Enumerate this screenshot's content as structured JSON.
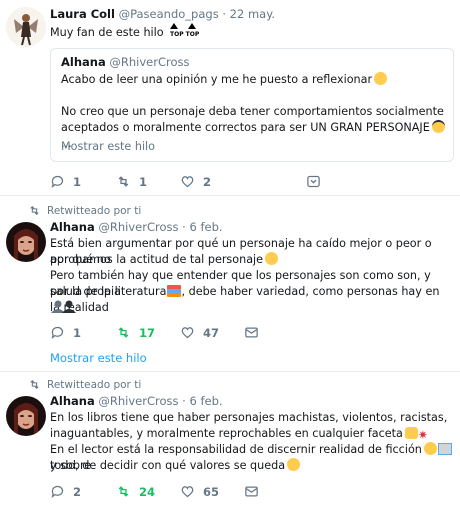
{
  "tweet1": {
    "name": "Laura Coll",
    "handle": "@Paseando_pags",
    "sep": "·",
    "date": "22 may.",
    "text": "Muy fan de este hilo",
    "emoji_label": "TOP TOP",
    "quote": {
      "name": "Alhana",
      "handle": "@RhiverCross",
      "line1": "Acabo de leer una opinión y me he puesto a reflexionar",
      "line2": "No creo que un personaje deba tener comportamientos socialmente",
      "line3": "aceptados o moralmente correctos para ser UN GRAN PERSONAJE",
      "ellipsis": "...",
      "more": "Mostrar este hilo"
    },
    "actions": {
      "replies": "1",
      "retweets": "1",
      "likes": "2"
    }
  },
  "tweet2": {
    "retweeted_by": "Retwitteado por ti",
    "name": "Alhana",
    "handle": "@RhiverCross",
    "sep": "·",
    "date": "6 feb.",
    "line1": "Está bien argumentar por qué un personaje ha caído mejor o peor o por qué no",
    "line2": "aprobamos la actitud de tal personaje",
    "line3": "Pero también hay que entender que los personajes son como son, y por la propia",
    "line4a": "salud de la literatura",
    "line4b": ", debe haber variedad, como personas hay en la realidad",
    "actions": {
      "replies": "1",
      "retweets": "17",
      "likes": "47"
    },
    "show_thread": "Mostrar este hilo"
  },
  "tweet3": {
    "retweeted_by": "Retwitteado por ti",
    "name": "Alhana",
    "handle": "@RhiverCross",
    "sep": "·",
    "date": "6 feb.",
    "line1": "En los libros tiene que haber personajes machistas, violentos, racistas,",
    "line2": "inaguantables, y moralmente reprochables en cualquier faceta",
    "line3a": "En el lector está la responsabilidad de discernir realidad de ficción",
    "line3b": "y sobre",
    "line4": "todo, de decidir con qué valores se queda",
    "actions": {
      "replies": "2",
      "retweets": "24",
      "likes": "65"
    }
  },
  "colors": {
    "text": "#14171a",
    "muted": "#657786",
    "link": "#1da1f2",
    "retweet_active": "#17bf63",
    "border": "#e6ecf0"
  },
  "icons": [
    "reply-icon",
    "retweet-icon",
    "like-icon",
    "message-icon",
    "caret-down-icon"
  ]
}
